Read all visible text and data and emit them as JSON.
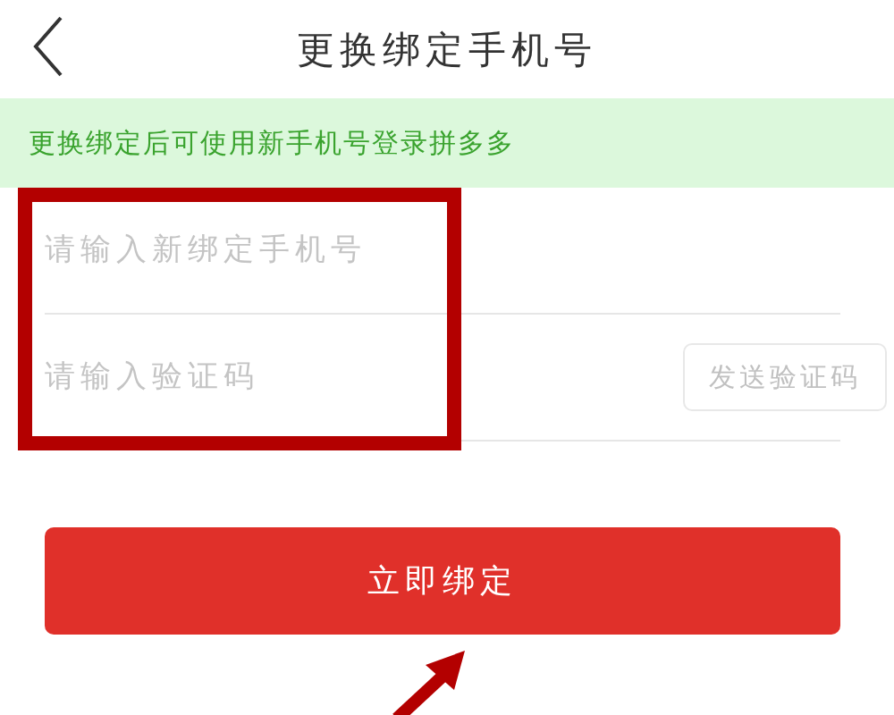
{
  "header": {
    "title": "更换绑定手机号"
  },
  "notice": "更换绑定后可使用新手机号登录拼多多",
  "form": {
    "phone": {
      "placeholder": "请输入新绑定手机号"
    },
    "code": {
      "placeholder": "请输入验证码"
    },
    "send_code_button": "发送验证码"
  },
  "submit_button": "立即绑定"
}
